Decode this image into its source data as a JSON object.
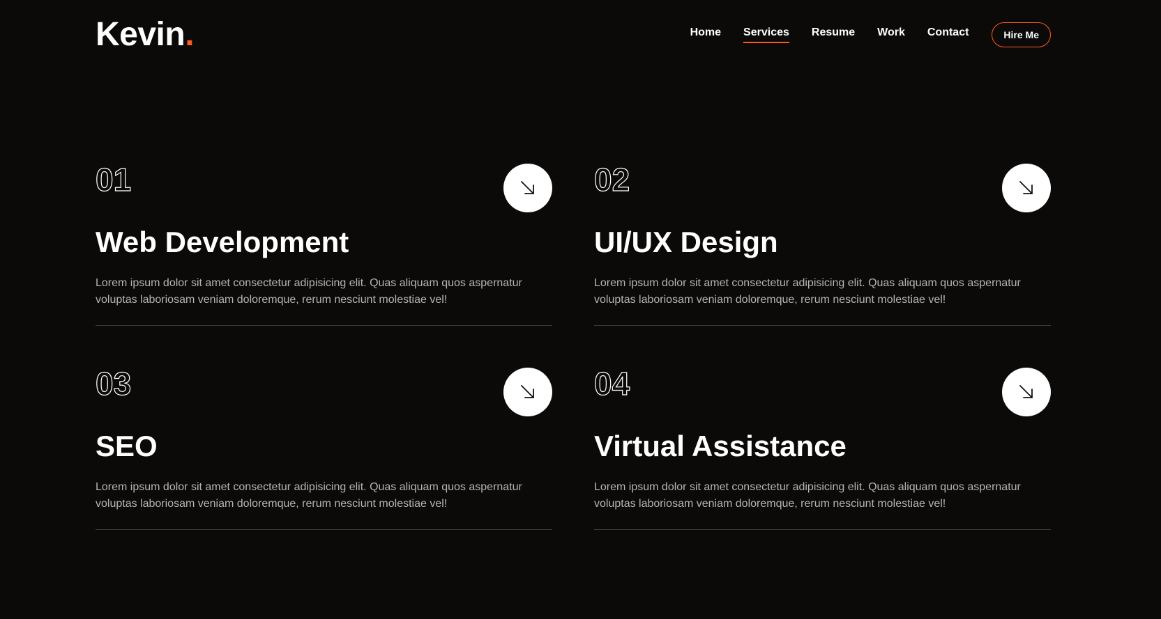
{
  "header": {
    "logo_text": "Kevin",
    "logo_dot": ".",
    "nav": [
      {
        "label": "Home",
        "active": false
      },
      {
        "label": "Services",
        "active": true
      },
      {
        "label": "Resume",
        "active": false
      },
      {
        "label": "Work",
        "active": false
      },
      {
        "label": "Contact",
        "active": false
      }
    ],
    "cta_label": "Hire Me"
  },
  "services": [
    {
      "number": "01",
      "title": "Web Development",
      "description": "Lorem ipsum dolor sit amet consectetur adipisicing elit. Quas aliquam quos aspernatur voluptas laboriosam veniam doloremque, rerum nesciunt molestiae vel!",
      "icon": "arrow-down-right-icon"
    },
    {
      "number": "02",
      "title": "UI/UX Design",
      "description": "Lorem ipsum dolor sit amet consectetur adipisicing elit. Quas aliquam quos aspernatur voluptas laboriosam veniam doloremque, rerum nesciunt molestiae vel!",
      "icon": "arrow-down-right-icon"
    },
    {
      "number": "03",
      "title": "SEO",
      "description": "Lorem ipsum dolor sit amet consectetur adipisicing elit. Quas aliquam quos aspernatur voluptas laboriosam veniam doloremque, rerum nesciunt molestiae vel!",
      "icon": "arrow-down-right-icon"
    },
    {
      "number": "04",
      "title": "Virtual Assistance",
      "description": "Lorem ipsum dolor sit amet consectetur adipisicing elit. Quas aliquam quos aspernatur voluptas laboriosam veniam doloremque, rerum nesciunt molestiae vel!",
      "icon": "arrow-down-right-icon"
    }
  ],
  "colors": {
    "background": "#0b0a09",
    "accent": "#ff5a1f",
    "text": "#ffffff",
    "muted_text": "#b8b4b0",
    "divider": "#3a3836"
  }
}
